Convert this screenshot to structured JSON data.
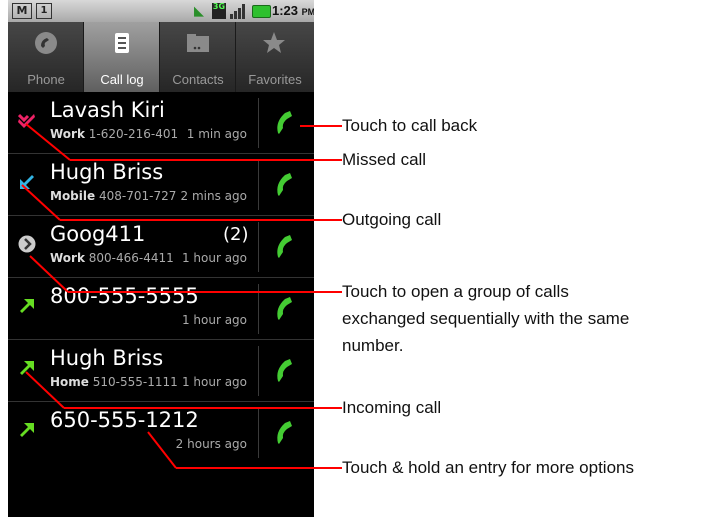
{
  "status_bar": {
    "time": "1:23",
    "ampm": "PM",
    "network": "3G"
  },
  "tabs": [
    {
      "label": "Phone",
      "icon": "phone-icon"
    },
    {
      "label": "Call log",
      "icon": "call-log-icon",
      "selected": true
    },
    {
      "label": "Contacts",
      "icon": "contacts-icon"
    },
    {
      "label": "Favorites",
      "icon": "star-icon"
    }
  ],
  "calls": [
    {
      "name": "Lavash Kiri",
      "type_label": "Work",
      "number": "1-620-216-401",
      "time": "1 min ago",
      "call_type": "missed"
    },
    {
      "name": "Hugh Briss",
      "type_label": "Mobile",
      "number": "408-701-727",
      "time": "2 mins ago",
      "call_type": "outgoing"
    },
    {
      "name": "Goog411",
      "count": "(2)",
      "type_label": "Work",
      "number": "800-466-4411",
      "time": "1 hour ago",
      "call_type": "group"
    },
    {
      "name": "800-555-5555",
      "type_label": "",
      "number": "",
      "time": "1 hour ago",
      "call_type": "incoming"
    },
    {
      "name": "Hugh Briss",
      "type_label": "Home",
      "number": "510-555-1111",
      "time": "1 hour ago",
      "call_type": "incoming"
    },
    {
      "name": "650-555-1212",
      "type_label": "",
      "number": "",
      "time": "2 hours ago",
      "call_type": "incoming"
    }
  ],
  "annotations": {
    "call_back": "Touch to call back",
    "missed": "Missed call",
    "outgoing": "Outgoing call",
    "group_line1": "Touch to open a group of calls",
    "group_line2": "exchanged sequentially with the same",
    "group_line3": "number.",
    "incoming": "Incoming call",
    "hold": "Touch & hold an entry for more options"
  },
  "colors": {
    "missed": "#ee2266",
    "outgoing": "#33b5e5",
    "incoming": "#66dd22",
    "call_button": "#44cc33",
    "annotation_line": "#ff0000"
  }
}
